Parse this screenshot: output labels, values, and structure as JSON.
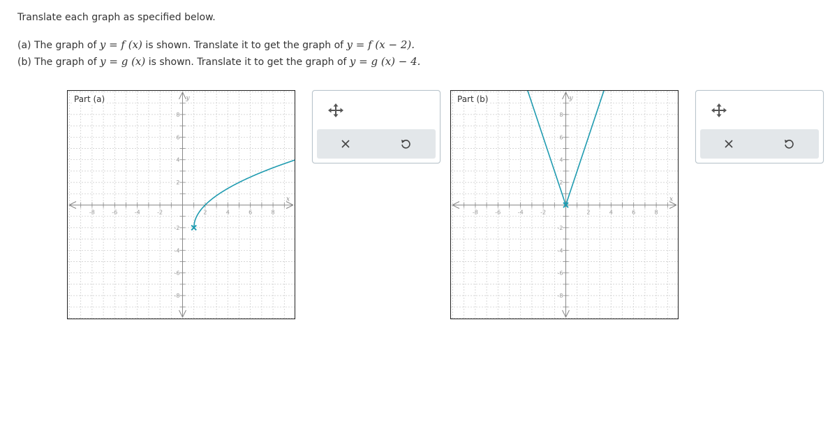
{
  "instructions": "Translate each graph as specified below.",
  "part_a": {
    "t1": "(a) The graph of ",
    "m1": "y = f (x)",
    "t2": " is shown. Translate it to get the graph of ",
    "m2": "y = f (x − 2).",
    "label": "Part (a)",
    "curve": {
      "type": "sqrt",
      "start": [
        1,
        -2
      ],
      "through": [
        [
          1,
          -2
        ],
        [
          2,
          0
        ],
        [
          5,
          2
        ],
        [
          10,
          4
        ]
      ]
    }
  },
  "part_b": {
    "t1": "(b) The graph of ",
    "m1": "y = g (x)",
    "t2": " is shown. Translate it to get the graph of ",
    "m2": "y = g (x) − 4.",
    "label": "Part (b)",
    "curve": {
      "type": "abs",
      "vertex": [
        0,
        0
      ],
      "slope": 3
    }
  },
  "axes": {
    "x_label": "x",
    "y_label": "y",
    "x_ticks": [
      "-8",
      "-6",
      "-4",
      "-2",
      "2",
      "4",
      "6",
      "8"
    ],
    "y_ticks": [
      "8",
      "6",
      "4",
      "2",
      "-2",
      "-4",
      "-6",
      "-8"
    ],
    "range": [
      -10,
      10
    ]
  },
  "colors": {
    "curve": "#1f9bb0",
    "grid": "#c8c8c8",
    "axis": "#888888"
  },
  "tools": {
    "move_icon": "move-arrows-icon",
    "clear_icon": "close-icon",
    "undo_icon": "undo-icon"
  }
}
